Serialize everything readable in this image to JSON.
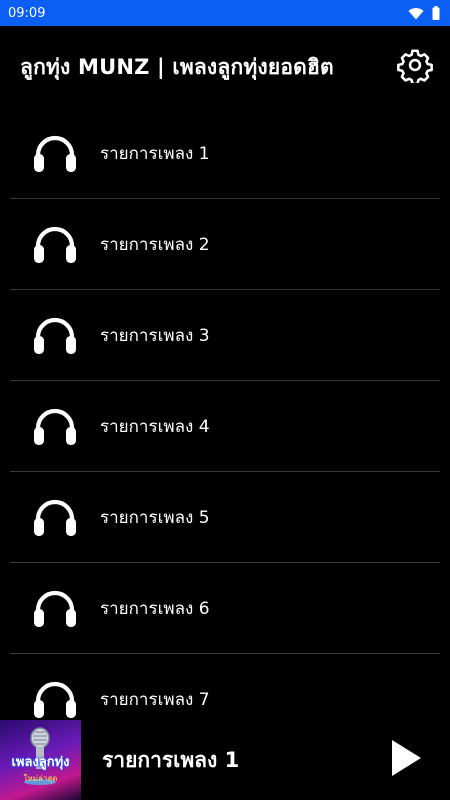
{
  "status_bar": {
    "time": "09:09",
    "icons": [
      "wifi-icon",
      "battery-icon"
    ]
  },
  "app_bar": {
    "title": "ลูกทุ่ง MUNZ | เพลงลูกทุ่งยอดฮิต",
    "settings_icon": "gear-icon"
  },
  "playlist": {
    "items": [
      {
        "label": "รายการเพลง 1",
        "icon": "headphones-icon"
      },
      {
        "label": "รายการเพลง 2",
        "icon": "headphones-icon"
      },
      {
        "label": "รายการเพลง 3",
        "icon": "headphones-icon"
      },
      {
        "label": "รายการเพลง 4",
        "icon": "headphones-icon"
      },
      {
        "label": "รายการเพลง 5",
        "icon": "headphones-icon"
      },
      {
        "label": "รายการเพลง 6",
        "icon": "headphones-icon"
      },
      {
        "label": "รายการเพลง 7",
        "icon": "headphones-icon"
      }
    ]
  },
  "player": {
    "album_art_text": "เพลงลูกทุ่ง",
    "album_art_subtext": "ใหม่ล่าสุด",
    "now_playing": "รายการเพลง 1",
    "play_icon": "play-icon"
  },
  "colors": {
    "status_bar": "#0b5ff5",
    "background": "#000000",
    "divider": "#3a3a3a",
    "text": "#ffffff"
  }
}
